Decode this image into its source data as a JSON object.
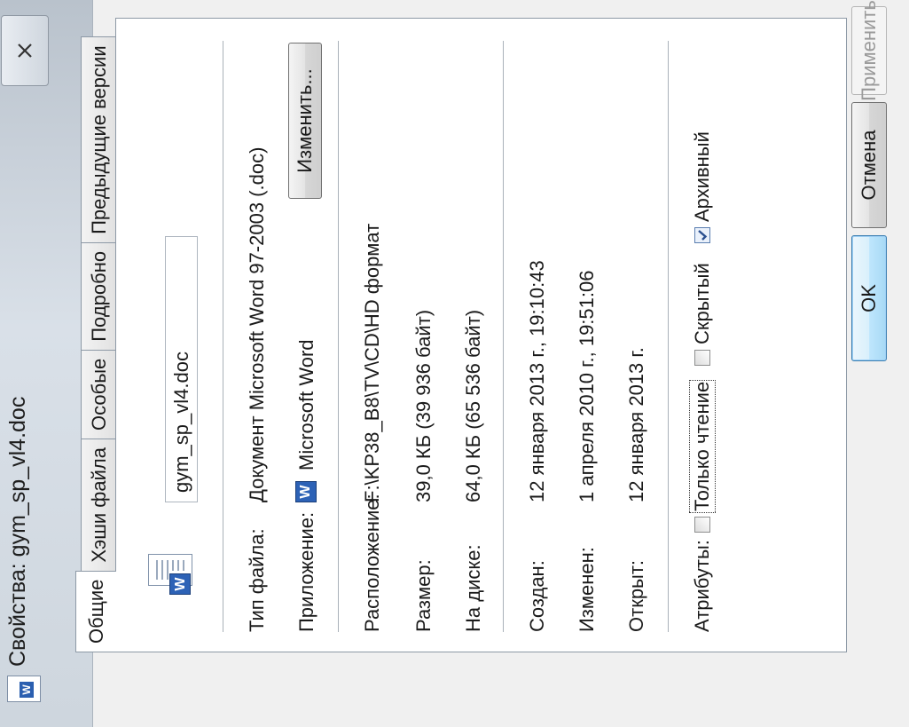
{
  "window": {
    "title": "Свойства: gym_sp_vl4.doc",
    "close_icon": "close-icon"
  },
  "tabs": [
    {
      "label": "Общие",
      "active": true
    },
    {
      "label": "Хэши файла",
      "active": false
    },
    {
      "label": "Особые",
      "active": false
    },
    {
      "label": "Подробно",
      "active": false
    },
    {
      "label": "Предыдущие версии",
      "active": false
    }
  ],
  "general": {
    "file_name": "gym_sp_vl4.doc",
    "file_type_label": "Тип файла:",
    "file_type_value": "Документ Microsoft Word 97-2003 (.doc)",
    "app_label": "Приложение:",
    "app_value": "Microsoft Word",
    "app_icon": "word-icon",
    "change_button": "Изменить...",
    "location_label": "Расположение:",
    "location_value": "F:\\KP38_B8\\TV\\CD\\HD формат",
    "size_label": "Размер:",
    "size_value": "39,0 КБ (39 936 байт)",
    "disk_label": "На диске:",
    "disk_value": "64,0 КБ (65 536 байт)",
    "created_label": "Создан:",
    "created_value": "12 января 2013 г., 19:10:43",
    "modified_label": "Изменен:",
    "modified_value": "1 апреля 2010 г., 19:51:06",
    "opened_label": "Открыт:",
    "opened_value": "12 января 2013 г.",
    "attributes_label": "Атрибуты:",
    "readonly_label": "Только чтение",
    "readonly_checked": false,
    "hidden_label": "Скрытый",
    "hidden_checked": false,
    "archive_label": "Архивный",
    "archive_checked": true
  },
  "footer": {
    "ok": "OK",
    "cancel": "Отмена",
    "apply": "Применить"
  }
}
